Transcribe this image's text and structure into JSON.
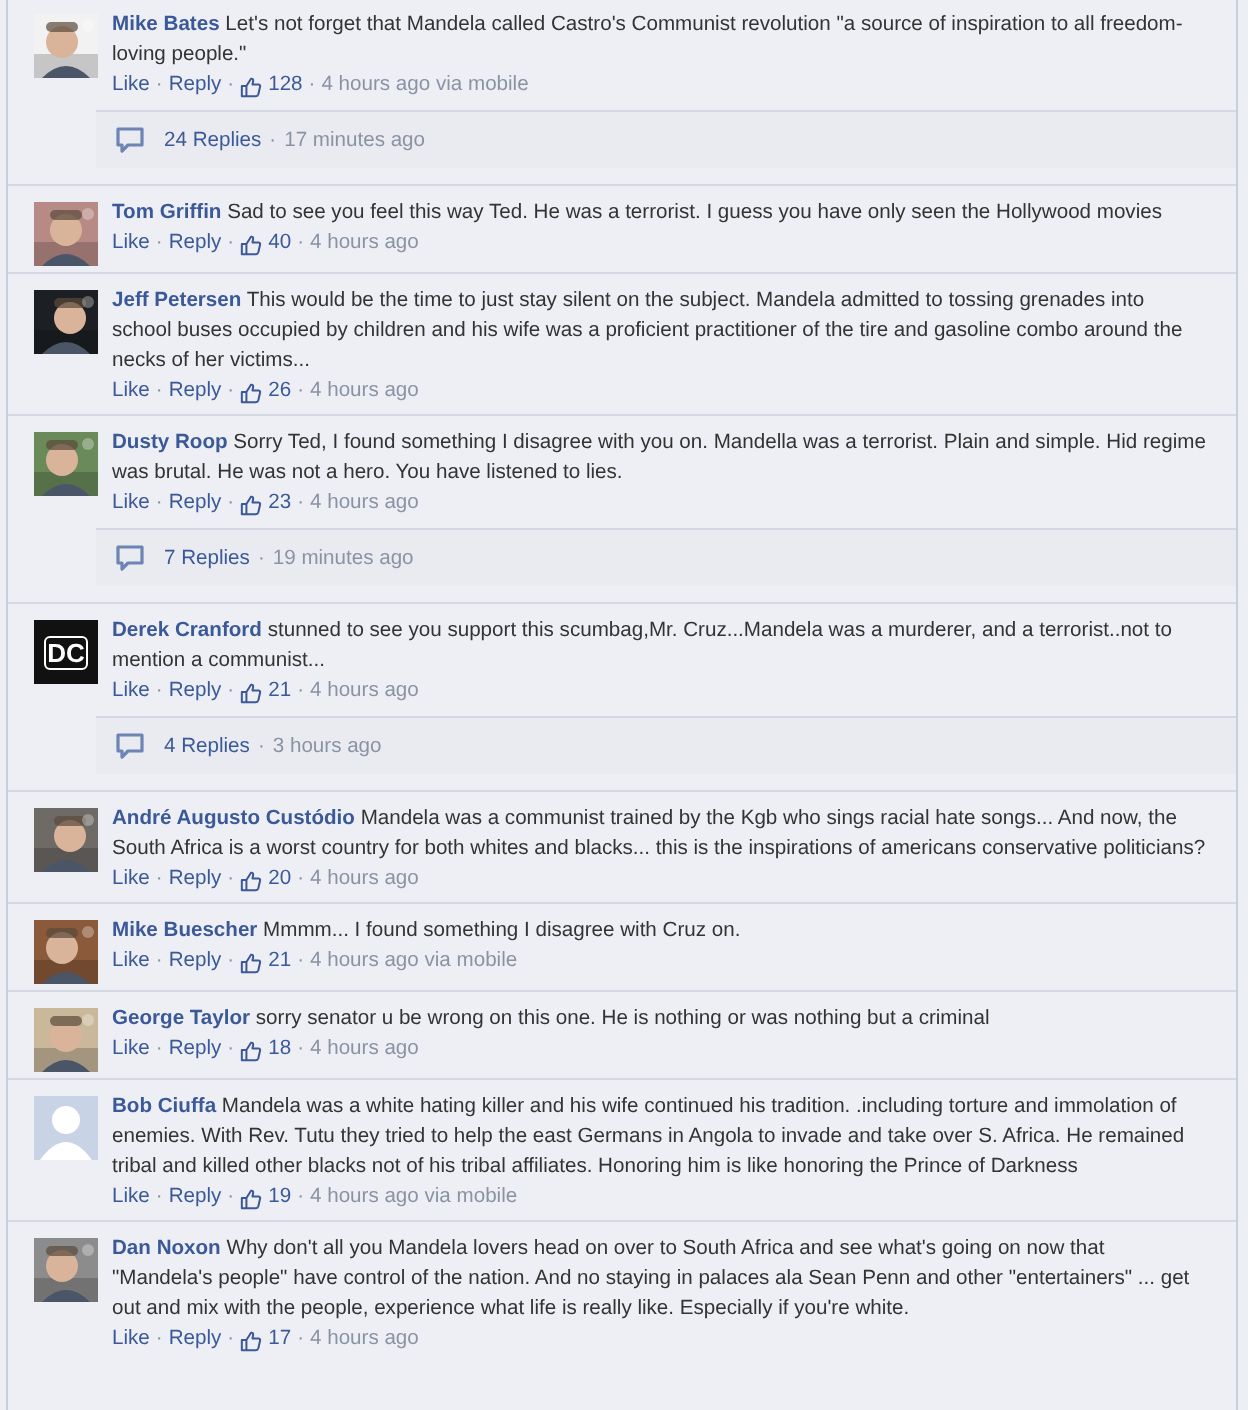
{
  "separator": "·",
  "comments": [
    {
      "name": "Mike Bates",
      "text": "Let's not forget that Mandela called Castro's Communist revolution \"a source of inspiration to all freedom-loving people.\"",
      "like": "Like",
      "reply": "Reply",
      "likes": "128",
      "time": "4 hours ago via mobile",
      "replies": {
        "count": "24 Replies",
        "time": "17 minutes ago"
      }
    },
    {
      "name": "Tom Griffin",
      "text": "Sad to see you feel this way Ted. He was a terrorist. I guess you have only seen the Hollywood movies",
      "like": "Like",
      "reply": "Reply",
      "likes": "40",
      "time": "4 hours ago"
    },
    {
      "name": "Jeff Petersen",
      "text": "This would be the time to just stay silent on the subject. Mandela admitted to tossing grenades into school buses occupied by children and his wife was a proficient practitioner of the tire and gasoline combo around the necks of her victims...",
      "like": "Like",
      "reply": "Reply",
      "likes": "26",
      "time": "4 hours ago"
    },
    {
      "name": "Dusty Roop",
      "text": "Sorry Ted, I found something I disagree with you on. Mandella was a terrorist. Plain and simple. Hid regime was brutal. He was not a hero. You have listened to lies.",
      "like": "Like",
      "reply": "Reply",
      "likes": "23",
      "time": "4 hours ago",
      "replies": {
        "count": "7 Replies",
        "time": "19 minutes ago"
      }
    },
    {
      "avatar": {
        "kind": "initials",
        "initials": "DC"
      },
      "name": "Derek Cranford",
      "text": "stunned to see you support this scumbag,Mr. Cruz...Mandela was a murderer, and a terrorist..not to mention a communist...",
      "like": "Like",
      "reply": "Reply",
      "likes": "21",
      "time": "4 hours ago",
      "replies": {
        "count": "4 Replies",
        "time": "3 hours ago"
      }
    },
    {
      "name": "André Augusto Custódio",
      "text": "Mandela was a communist trained by the Kgb who sings racial hate songs... And now, the South Africa is a worst country for both whites and blacks... this is the inspirations of americans conservative politicians?",
      "like": "Like",
      "reply": "Reply",
      "likes": "20",
      "time": "4 hours ago"
    },
    {
      "name": "Mike Buescher",
      "text": "Mmmm... I found something I disagree with Cruz on.",
      "like": "Like",
      "reply": "Reply",
      "likes": "21",
      "time": "4 hours ago via mobile"
    },
    {
      "name": "George Taylor",
      "text": "sorry senator u be wrong on this one. He is nothing or was nothing but a criminal",
      "like": "Like",
      "reply": "Reply",
      "likes": "18",
      "time": "4 hours ago"
    },
    {
      "avatar": {
        "kind": "silhouette"
      },
      "name": "Bob Ciuffa",
      "text": "Mandela was a white hating killer and his wife continued his tradition. .including torture and immolation of enemies. With Rev. Tutu they tried to help the east Germans in Angola to invade and take over S. Africa. He remained tribal and killed other blacks not of his tribal affiliates. Honoring him is like honoring the Prince of Darkness",
      "like": "Like",
      "reply": "Reply",
      "likes": "19",
      "time": "4 hours ago via mobile"
    },
    {
      "name": "Dan Noxon",
      "text": "Why don't all you Mandela lovers head on over to South Africa and see what's going on now that \"Mandela's people\" have control of the nation. And no staying in palaces ala Sean Penn and other \"entertainers\" ... get out and mix with the people, experience what life is really like. Especially if you're white.",
      "like": "Like",
      "reply": "Reply",
      "likes": "17",
      "time": "4 hours ago"
    }
  ]
}
